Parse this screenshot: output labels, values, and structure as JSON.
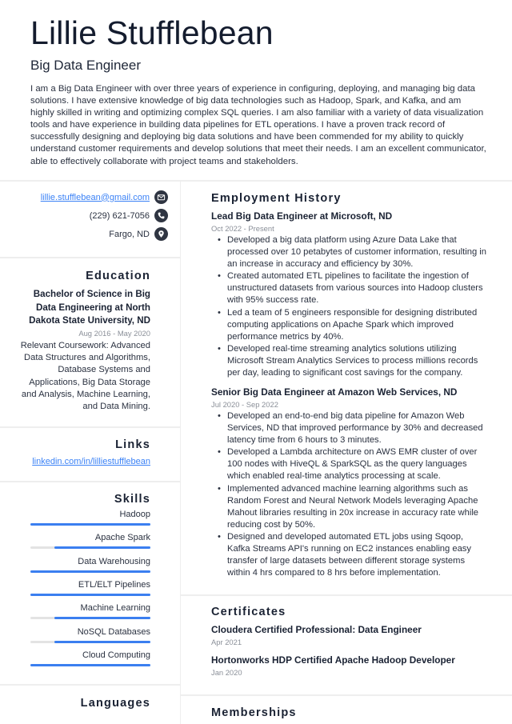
{
  "header": {
    "name": "Lillie Stufflebean",
    "title": "Big Data Engineer",
    "summary": "I am a Big Data Engineer with over three years of experience in configuring, deploying, and managing big data solutions. I have extensive knowledge of big data technologies such as Hadoop, Spark, and Kafka, and am highly skilled in writing and optimizing complex SQL queries. I am also familiar with a variety of data visualization tools and have experience in building data pipelines for ETL operations. I have a proven track record of successfully designing and deploying big data solutions and have been commended for my ability to quickly understand customer requirements and develop solutions that meet their needs. I am an excellent communicator, able to effectively collaborate with project teams and stakeholders."
  },
  "contact": {
    "email": "lillie.stufflebean@gmail.com",
    "email_icon": "envelope-icon",
    "phone": "(229) 621-7056",
    "phone_icon": "phone-icon",
    "location": "Fargo, ND",
    "location_icon": "map-pin-icon"
  },
  "education": {
    "heading": "Education",
    "degree": "Bachelor of Science in Big Data Engineering at North Dakota State University, ND",
    "dates": "Aug 2016 - May 2020",
    "description": "Relevant Coursework: Advanced Data Structures and Algorithms, Database Systems and Applications, Big Data Storage and Analysis, Machine Learning, and Data Mining."
  },
  "links": {
    "heading": "Links",
    "items": [
      "linkedin.com/in/lilliestufflebean"
    ]
  },
  "skills": {
    "heading": "Skills",
    "items": [
      {
        "name": "Hadoop",
        "level": 1.0
      },
      {
        "name": "Apache Spark",
        "level": 0.8
      },
      {
        "name": "Data Warehousing",
        "level": 1.0
      },
      {
        "name": "ETL/ELT Pipelines",
        "level": 1.0
      },
      {
        "name": "Machine Learning",
        "level": 0.8
      },
      {
        "name": "NoSQL Databases",
        "level": 0.8
      },
      {
        "name": "Cloud Computing",
        "level": 1.0
      }
    ]
  },
  "languages": {
    "heading": "Languages"
  },
  "employment": {
    "heading": "Employment History",
    "jobs": [
      {
        "title": "Lead Big Data Engineer at Microsoft, ND",
        "dates": "Oct 2022 - Present",
        "bullets": [
          "Developed a big data platform using Azure Data Lake that processed over 10 petabytes of customer information, resulting in an increase in accuracy and efficiency by 30%.",
          "Created automated ETL pipelines to facilitate the ingestion of unstructured datasets from various sources into Hadoop clusters with 95% success rate.",
          "Led a team of 5 engineers responsible for designing distributed computing applications on Apache Spark which improved performance metrics by 40%.",
          "Developed real-time streaming analytics solutions utilizing Microsoft Stream Analytics Services to process millions records per day, leading to significant cost savings for the company."
        ]
      },
      {
        "title": "Senior Big Data Engineer at Amazon Web Services, ND",
        "dates": "Jul 2020 - Sep 2022",
        "bullets": [
          "Developed an end-to-end big data pipeline for Amazon Web Services, ND that improved performance by 30% and decreased latency time from 6 hours to 3 minutes.",
          "Developed a Lambda architecture on AWS EMR cluster of over 100 nodes with HiveQL & SparkSQL as the query languages which enabled real-time analytics processing at scale.",
          "Implemented advanced machine learning algorithms such as Random Forest and Neural Network Models leveraging Apache Mahout libraries resulting in 20x increase in accuracy rate while reducing cost by 50%.",
          "Designed and developed automated ETL jobs using Sqoop, Kafka Streams API's running on EC2 instances enabling easy transfer of large datasets between different storage systems within 4 hrs compared to 8 hrs before implementation."
        ]
      }
    ]
  },
  "certificates": {
    "heading": "Certificates",
    "items": [
      {
        "name": "Cloudera Certified Professional: Data Engineer",
        "date": "Apr 2021"
      },
      {
        "name": "Hortonworks HDP Certified Apache Hadoop Developer",
        "date": "Jan 2020"
      }
    ]
  },
  "memberships": {
    "heading": "Memberships"
  },
  "colors": {
    "accent": "#3b7ff0",
    "link": "#3b82f6",
    "text": "#1a2233",
    "muted": "#8a8f98",
    "divider": "#eeeeee"
  }
}
